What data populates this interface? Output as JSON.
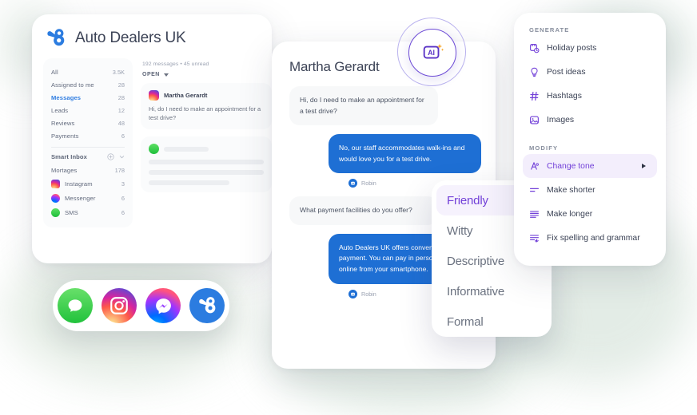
{
  "brand": {
    "title": "Auto Dealers UK",
    "logo_icon": "bird-logo-icon",
    "accent": "#2b7ce0"
  },
  "sidebar": {
    "items": [
      {
        "label": "All",
        "count": "3.5K",
        "active": false
      },
      {
        "label": "Assigned to me",
        "count": "28",
        "active": false
      },
      {
        "label": "Messages",
        "count": "28",
        "active": true
      },
      {
        "label": "Leads",
        "count": "12",
        "active": false
      },
      {
        "label": "Reviews",
        "count": "48",
        "active": false
      },
      {
        "label": "Payments",
        "count": "6",
        "active": false
      }
    ],
    "smart_inbox": {
      "label": "Smart Inbox",
      "add_icon": "plus-circle-icon",
      "expand_icon": "chevron-down-icon"
    },
    "channels": [
      {
        "label": "Mortages",
        "count": "178",
        "icon": "none"
      },
      {
        "label": "Instagram",
        "count": "3",
        "icon": "instagram-icon"
      },
      {
        "label": "Messenger",
        "count": "6",
        "icon": "messenger-icon"
      },
      {
        "label": "SMS",
        "count": "6",
        "icon": "sms-icon"
      }
    ]
  },
  "thread_list": {
    "meta": "192 messages • 45 unread",
    "filter_label": "OPEN",
    "filter_icon": "caret-down-icon",
    "threads": [
      {
        "name": "Martha Gerardt",
        "avatar_icon": "instagram-icon",
        "preview": "Hi, do I need to make an appointment for a test drive?"
      },
      {
        "name": "",
        "avatar_icon": "sms-icon",
        "preview": ""
      }
    ]
  },
  "conversation": {
    "title": "Martha Gerardt",
    "messages": [
      {
        "direction": "in",
        "text": "Hi, do I need to make an appointment for a test drive?",
        "sender": ""
      },
      {
        "direction": "out",
        "text": "No, our staff accommodates walk-ins and would love you for a test drive.",
        "sender": "Robin",
        "sender_avatar_icon": "robot-avatar-icon"
      },
      {
        "direction": "in",
        "text": "What payment facilities do you offer?",
        "sender": ""
      },
      {
        "direction": "out",
        "text": "Auto Dealers UK offers convenient online payment. You can pay in person or pay online from your smartphone.",
        "sender": "Robin",
        "sender_avatar_icon": "robot-avatar-icon"
      }
    ]
  },
  "ai_badge": {
    "label": "AI",
    "icon": "ai-sparkle-icon",
    "ring_color": "#6d4bd6"
  },
  "tone_menu": {
    "items": [
      {
        "label": "Friendly",
        "selected": true
      },
      {
        "label": "Witty",
        "selected": false
      },
      {
        "label": "Descriptive",
        "selected": false
      },
      {
        "label": "Informative",
        "selected": false
      },
      {
        "label": "Formal",
        "selected": false
      }
    ]
  },
  "assistant_panel": {
    "generate_heading": "GENERATE",
    "generate_items": [
      {
        "label": "Holiday posts",
        "icon": "holiday-posts-icon"
      },
      {
        "label": "Post ideas",
        "icon": "lightbulb-icon"
      },
      {
        "label": "Hashtags",
        "icon": "hashtag-icon"
      },
      {
        "label": "Images",
        "icon": "image-icon"
      }
    ],
    "modify_heading": "MODIFY",
    "modify_items": [
      {
        "label": "Change tone",
        "icon": "change-tone-icon",
        "selected": true,
        "has_submenu": true
      },
      {
        "label": "Make shorter",
        "icon": "make-shorter-icon",
        "selected": false,
        "has_submenu": false
      },
      {
        "label": "Make longer",
        "icon": "make-longer-icon",
        "selected": false,
        "has_submenu": false
      },
      {
        "label": "Fix spelling and grammar",
        "icon": "spellcheck-icon",
        "selected": false,
        "has_submenu": false
      }
    ],
    "accent": "#7240d8"
  },
  "social_pill": {
    "channels": [
      {
        "name": "sms-icon"
      },
      {
        "name": "instagram-icon"
      },
      {
        "name": "messenger-icon"
      },
      {
        "name": "bird-logo-icon"
      }
    ]
  }
}
